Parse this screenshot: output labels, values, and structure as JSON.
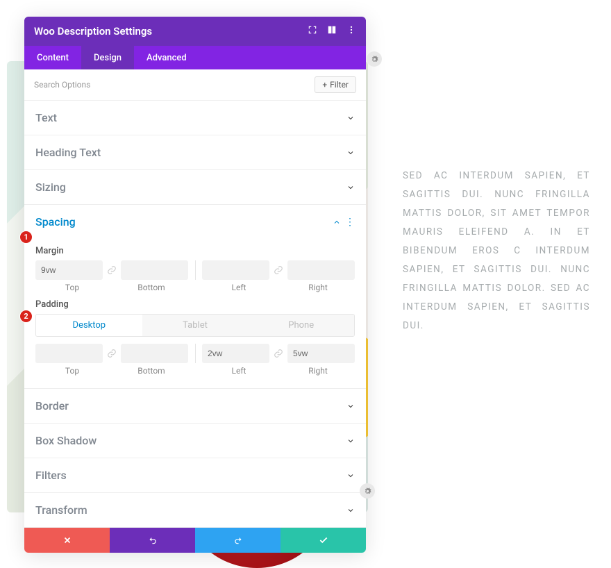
{
  "header": {
    "title": "Woo Description Settings"
  },
  "tabs": {
    "content": "Content",
    "design": "Design",
    "advanced": "Advanced",
    "active": "Design"
  },
  "search": {
    "placeholder": "Search Options",
    "filter_label": "Filter"
  },
  "sections": {
    "text": "Text",
    "heading_text": "Heading Text",
    "sizing": "Sizing",
    "spacing": "Spacing",
    "border": "Border",
    "box_shadow": "Box Shadow",
    "filters": "Filters",
    "transform": "Transform"
  },
  "spacing": {
    "margin_label": "Margin",
    "padding_label": "Padding",
    "margin": {
      "top": "9vw",
      "bottom": "",
      "left": "",
      "right": ""
    },
    "padding": {
      "top": "",
      "bottom": "",
      "left": "2vw",
      "right": "5vw"
    },
    "device_tabs": {
      "desktop": "Desktop",
      "tablet": "Tablet",
      "phone": "Phone",
      "active": "Desktop"
    },
    "edge_labels": {
      "top": "Top",
      "bottom": "Bottom",
      "left": "Left",
      "right": "Right"
    }
  },
  "annotations": {
    "one": "1",
    "two": "2"
  },
  "preview_text": "SED AC INTERDUM SAPIEN, ET SAGITTIS DUI. NUNC FRINGILLA MATTIS DOLOR, SIT AMET TEMPOR MAURIS ELEIFEND A. IN ET BIBENDUM EROS C INTERDUM SAPIEN, ET SAGITTIS DUI. NUNC FRINGILLA MATTIS DOLOR. SED AC INTERDUM SAPIEN, ET SAGITTIS DUI."
}
